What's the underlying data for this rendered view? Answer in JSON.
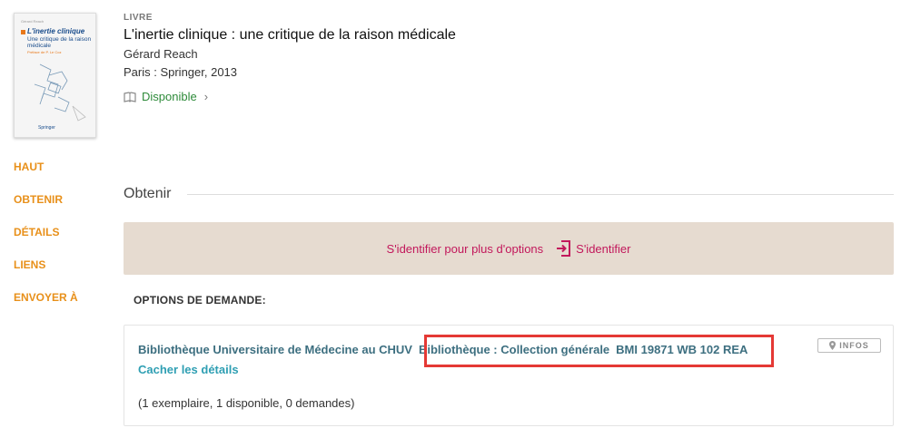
{
  "record": {
    "type": "LIVRE",
    "title": "L'inertie clinique : une critique de la raison médicale",
    "author": "Gérard Reach",
    "publication": "Paris : Springer, 2013",
    "availability": "Disponible",
    "status_color": "#2e8b3a"
  },
  "cover": {
    "publisher_small": "Gérard Reach",
    "title": "L'inertie clinique",
    "subtitle": "Une critique de la raison médicale",
    "foreword": "Préface de P. Le Coz",
    "logo": "Springer"
  },
  "nav": {
    "items": [
      "HAUT",
      "OBTENIR",
      "DÉTAILS",
      "LIENS",
      "ENVOYER À"
    ]
  },
  "obtain": {
    "heading": "Obtenir",
    "login_message": "S'identifier pour plus d'options",
    "login_button": "S'identifier",
    "options_label": "OPTIONS DE DEMANDE:"
  },
  "holding": {
    "library": "Bibliothèque Universitaire de Médecine au CHUV",
    "location": "Bibliothèque : Collection générale",
    "call_number": "BMI 19871 WB 102 REA",
    "hide_details": "Cacher les détails",
    "counts": "(1 exemplaire, 1 disponible, 0 demandes)",
    "infos_label": "INFOS"
  },
  "colors": {
    "nav_accent": "#e8901a",
    "link_pink": "#c2185b",
    "login_bg": "#e6dbd0",
    "highlight": "#e53935"
  },
  "icons": {
    "availability": "book-icon",
    "chevron": "chevron-right-icon",
    "login": "sign-in-icon",
    "infos": "map-pin-icon"
  }
}
